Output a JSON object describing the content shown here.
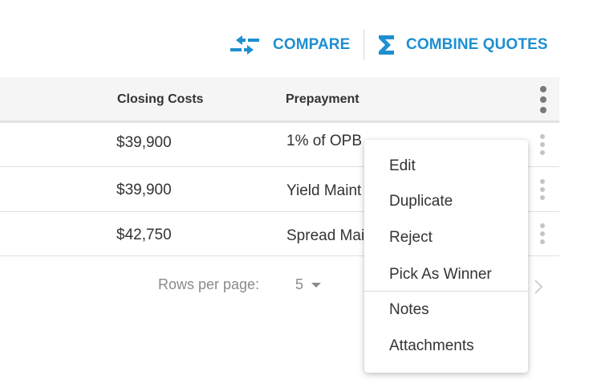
{
  "toolbar": {
    "compare_label": "COMPARE",
    "compare_icon": "compare-arrows-icon",
    "combine_label": "COMBINE QUOTES",
    "combine_icon": "sigma-icon",
    "accent_color": "#1e8fd0"
  },
  "table": {
    "columns": [
      "Closing Costs",
      "Prepayment"
    ],
    "rows": [
      {
        "closing_costs": "$39,900",
        "prepayment": "1% of OPB"
      },
      {
        "closing_costs": "$39,900",
        "prepayment": "Yield Maint"
      },
      {
        "closing_costs": "$42,750",
        "prepayment": "Spread Mai"
      }
    ]
  },
  "pagination": {
    "rows_per_page_label": "Rows per page:",
    "rows_per_page_value": "5",
    "next_icon": "chevron-right-icon"
  },
  "context_menu": {
    "items": [
      "Edit",
      "Duplicate",
      "Reject",
      "Pick As Winner",
      "Notes",
      "Attachments"
    ]
  }
}
